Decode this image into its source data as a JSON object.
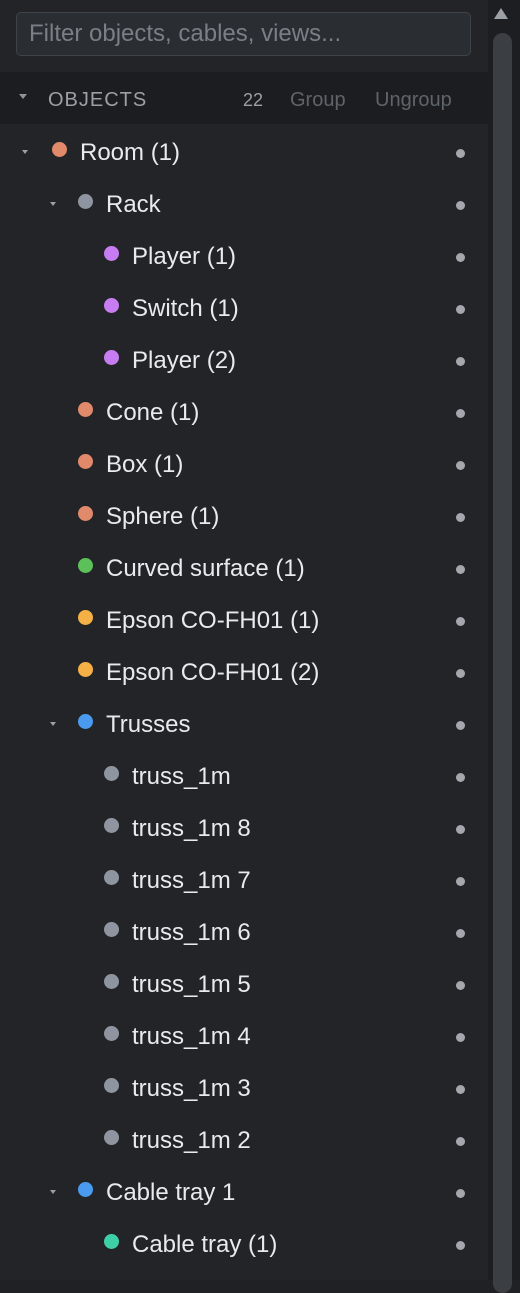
{
  "search": {
    "placeholder": "Filter objects, cables, views..."
  },
  "objects_section": {
    "title": "OBJECTS",
    "count": "22",
    "group_label": "Group",
    "ungroup_label": "Ungroup"
  },
  "colors": {
    "room": "#e0896b",
    "rack": "#8e95a0",
    "player": "#c77cf2",
    "primitive": "#e0896b",
    "surface": "#5cc15a",
    "projector": "#f5b146",
    "trusses": "#4a9bf0",
    "truss": "#8e95a0",
    "cable_tray_group": "#4a9bf0",
    "cable_tray": "#3fcfa8"
  },
  "tree": {
    "items": [
      {
        "label": "Room (1)",
        "level": 0,
        "expandable": true,
        "color": "#e0896b"
      },
      {
        "label": "Rack",
        "level": 1,
        "expandable": true,
        "color": "#8e95a0"
      },
      {
        "label": "Player (1)",
        "level": 2,
        "expandable": false,
        "color": "#c77cf2"
      },
      {
        "label": "Switch (1)",
        "level": 2,
        "expandable": false,
        "color": "#c77cf2"
      },
      {
        "label": "Player (2)",
        "level": 2,
        "expandable": false,
        "color": "#c77cf2"
      },
      {
        "label": "Cone (1)",
        "level": 1,
        "expandable": false,
        "color": "#e0896b"
      },
      {
        "label": "Box (1)",
        "level": 1,
        "expandable": false,
        "color": "#e0896b"
      },
      {
        "label": "Sphere (1)",
        "level": 1,
        "expandable": false,
        "color": "#e0896b"
      },
      {
        "label": "Curved surface (1)",
        "level": 1,
        "expandable": false,
        "color": "#5cc15a"
      },
      {
        "label": "Epson CO-FH01 (1)",
        "level": 1,
        "expandable": false,
        "color": "#f5b146"
      },
      {
        "label": "Epson CO-FH01 (2)",
        "level": 1,
        "expandable": false,
        "color": "#f5b146"
      },
      {
        "label": "Trusses",
        "level": 1,
        "expandable": true,
        "color": "#4a9bf0"
      },
      {
        "label": "truss_1m",
        "level": 2,
        "expandable": false,
        "color": "#8e95a0"
      },
      {
        "label": "truss_1m 8",
        "level": 2,
        "expandable": false,
        "color": "#8e95a0"
      },
      {
        "label": "truss_1m 7",
        "level": 2,
        "expandable": false,
        "color": "#8e95a0"
      },
      {
        "label": "truss_1m 6",
        "level": 2,
        "expandable": false,
        "color": "#8e95a0"
      },
      {
        "label": "truss_1m 5",
        "level": 2,
        "expandable": false,
        "color": "#8e95a0"
      },
      {
        "label": "truss_1m 4",
        "level": 2,
        "expandable": false,
        "color": "#8e95a0"
      },
      {
        "label": "truss_1m 3",
        "level": 2,
        "expandable": false,
        "color": "#8e95a0"
      },
      {
        "label": "truss_1m 2",
        "level": 2,
        "expandable": false,
        "color": "#8e95a0"
      },
      {
        "label": "Cable tray 1",
        "level": 1,
        "expandable": true,
        "color": "#4a9bf0"
      },
      {
        "label": "Cable tray (1)",
        "level": 2,
        "expandable": false,
        "color": "#3fcfa8"
      }
    ]
  }
}
